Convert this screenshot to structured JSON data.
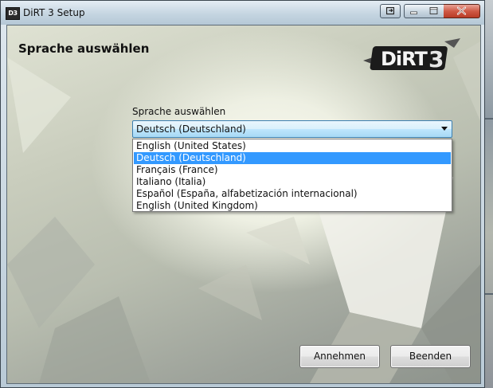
{
  "window": {
    "title": "DiRT 3 Setup",
    "app_icon_text": "D3"
  },
  "page": {
    "heading": "Sprache auswählen"
  },
  "logo": {
    "text": "DiRT3"
  },
  "language": {
    "label": "Sprache auswählen",
    "selected": "Deutsch (Deutschland)",
    "options": [
      "English (United States)",
      "Deutsch (Deutschland)",
      "Français (France)",
      "Italiano (Italia)",
      "Español (España, alfabetización internacional)",
      "English (United Kingdom)"
    ],
    "highlighted_index": 1
  },
  "buttons": {
    "accept": "Annehmen",
    "exit": "Beenden"
  },
  "colors": {
    "selection": "#3399ff",
    "close_button": "#c8472f"
  }
}
